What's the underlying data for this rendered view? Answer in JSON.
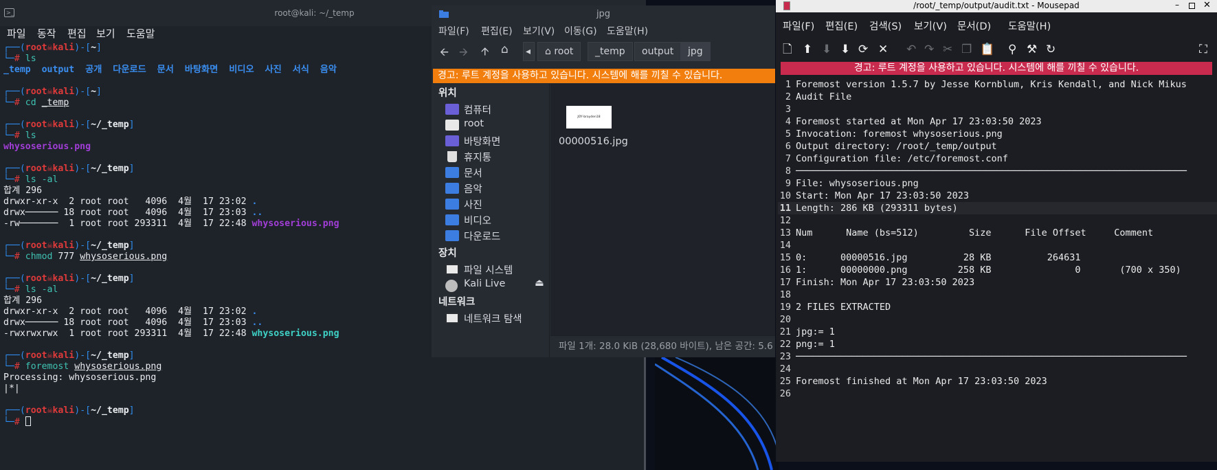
{
  "terminal": {
    "title": "root@kali: ~/_temp",
    "menu": [
      "파일",
      "동작",
      "편집",
      "보기",
      "도움말"
    ],
    "lines": [
      {
        "type": "prompt",
        "user": "root",
        "host": "kali",
        "dir": "~"
      },
      {
        "type": "cmd",
        "parts": [
          {
            "t": "ls",
            "c": "cmd"
          }
        ]
      },
      {
        "type": "out",
        "parts": [
          {
            "t": "_temp  output  공개  다운로드  문서  바탕화면  비디오  사진  서식  음악",
            "c": "dirblue"
          }
        ]
      },
      {
        "type": "blank"
      },
      {
        "type": "prompt",
        "user": "root",
        "host": "kali",
        "dir": "~"
      },
      {
        "type": "cmd",
        "parts": [
          {
            "t": "cd ",
            "c": "cmd"
          },
          {
            "t": "_temp",
            "c": "wh ul"
          }
        ]
      },
      {
        "type": "blank"
      },
      {
        "type": "prompt",
        "user": "root",
        "host": "kali",
        "dir": "~/_temp"
      },
      {
        "type": "cmd",
        "parts": [
          {
            "t": "ls",
            "c": "cmd"
          }
        ]
      },
      {
        "type": "out",
        "parts": [
          {
            "t": "whysoserious.png",
            "c": "pu"
          }
        ]
      },
      {
        "type": "blank"
      },
      {
        "type": "prompt",
        "user": "root",
        "host": "kali",
        "dir": "~/_temp"
      },
      {
        "type": "cmd",
        "parts": [
          {
            "t": "ls -al",
            "c": "cmd"
          }
        ]
      },
      {
        "type": "out",
        "parts": [
          {
            "t": "합계 296",
            "c": "wh"
          }
        ]
      },
      {
        "type": "out",
        "parts": [
          {
            "t": "drwxr-xr-x  2 root root   4096  4월  17 23:02 ",
            "c": "wh"
          },
          {
            "t": ".",
            "c": "dirblue"
          }
        ]
      },
      {
        "type": "out",
        "parts": [
          {
            "t": "drwx────── 18 root root   4096  4월  17 23:03 ",
            "c": "wh"
          },
          {
            "t": "..",
            "c": "dirblue"
          }
        ]
      },
      {
        "type": "out",
        "parts": [
          {
            "t": "-rw───────  1 root root 293311  4월  17 22:48 ",
            "c": "wh"
          },
          {
            "t": "whysoserious.png",
            "c": "pu"
          }
        ]
      },
      {
        "type": "blank"
      },
      {
        "type": "prompt",
        "user": "root",
        "host": "kali",
        "dir": "~/_temp"
      },
      {
        "type": "cmd",
        "parts": [
          {
            "t": "chmod ",
            "c": "cmd"
          },
          {
            "t": "777 ",
            "c": "wh"
          },
          {
            "t": "whysoserious.png",
            "c": "wh ul"
          }
        ]
      },
      {
        "type": "blank"
      },
      {
        "type": "prompt",
        "user": "root",
        "host": "kali",
        "dir": "~/_temp"
      },
      {
        "type": "cmd",
        "parts": [
          {
            "t": "ls -al",
            "c": "cmd"
          }
        ]
      },
      {
        "type": "out",
        "parts": [
          {
            "t": "합계 296",
            "c": "wh"
          }
        ]
      },
      {
        "type": "out",
        "parts": [
          {
            "t": "drwxr-xr-x  2 root root   4096  4월  17 23:02 ",
            "c": "wh"
          },
          {
            "t": ".",
            "c": "dirblue"
          }
        ]
      },
      {
        "type": "out",
        "parts": [
          {
            "t": "drwx────── 18 root root   4096  4월  17 23:03 ",
            "c": "wh"
          },
          {
            "t": "..",
            "c": "dirblue"
          }
        ]
      },
      {
        "type": "out",
        "parts": [
          {
            "t": "-rwxrwxrwx  1 root root 293311  4월  17 22:48 ",
            "c": "wh"
          },
          {
            "t": "whysoserious.png",
            "c": "cy"
          }
        ]
      },
      {
        "type": "blank"
      },
      {
        "type": "prompt",
        "user": "root",
        "host": "kali",
        "dir": "~/_temp"
      },
      {
        "type": "cmd",
        "parts": [
          {
            "t": "foremost ",
            "c": "cmd"
          },
          {
            "t": "whysoserious.png",
            "c": "wh ul"
          }
        ]
      },
      {
        "type": "out",
        "parts": [
          {
            "t": "Processing: whysoserious.png",
            "c": "wh"
          }
        ]
      },
      {
        "type": "out",
        "parts": [
          {
            "t": "|*|",
            "c": "wh"
          }
        ]
      },
      {
        "type": "blank"
      },
      {
        "type": "prompt",
        "user": "root",
        "host": "kali",
        "dir": "~/_temp"
      },
      {
        "type": "cursorline"
      }
    ]
  },
  "filemanager": {
    "title": "jpg",
    "menu": [
      "파일(F)",
      "편집(E)",
      "보기(V)",
      "이동(G)",
      "도움말(H)"
    ],
    "breadcrumbs": [
      "root",
      "_temp",
      "output",
      "jpg"
    ],
    "warning": "경고: 루트 계정을 사용하고 있습니다. 시스템에 해를 끼칠 수 있습니다.",
    "places_header": "위치",
    "places": [
      {
        "label": "컴퓨터",
        "icon": "computer-icon",
        "color": "#6a5fd6"
      },
      {
        "label": "root",
        "icon": "home-folder-icon",
        "color": "#e8e8e8"
      },
      {
        "label": "바탕화면",
        "icon": "desktop-icon",
        "color": "#6a5fd6"
      },
      {
        "label": "휴지통",
        "icon": "trash-icon",
        "color": "#e0e0e0"
      },
      {
        "label": "문서",
        "icon": "documents-folder-icon",
        "color": "#3b7de0"
      },
      {
        "label": "음악",
        "icon": "music-folder-icon",
        "color": "#3b7de0"
      },
      {
        "label": "사진",
        "icon": "pictures-folder-icon",
        "color": "#3b7de0"
      },
      {
        "label": "비디오",
        "icon": "videos-folder-icon",
        "color": "#3b7de0"
      },
      {
        "label": "다운로드",
        "icon": "downloads-folder-icon",
        "color": "#3b7de0"
      }
    ],
    "devices_header": "장치",
    "devices": [
      {
        "label": "파일 시스템",
        "icon": "drive-icon"
      },
      {
        "label": "Kali Live",
        "icon": "disc-icon"
      }
    ],
    "network_header": "네트워크",
    "network": [
      {
        "label": "네트워크 탐색",
        "icon": "network-icon"
      }
    ],
    "file": {
      "name": "00000516.jpg",
      "thumb_text": "JOY·brayden18"
    },
    "status": "파일 1개: 28.0 KiB (28,680 바이트), 남은 공간: 5.6"
  },
  "mousepad": {
    "title": "/root/_temp/output/audit.txt - Mousepad",
    "menu": [
      "파일(F)",
      "편집(E)",
      "검색(S)",
      "보기(V)",
      "문서(D)",
      "도움말(H)"
    ],
    "warning": "경고: 루트 계정을 사용하고 있습니다. 시스템에 해를 끼칠 수 있습니다.",
    "lines": [
      "Foremost version 1.5.7 by Jesse Kornblum, Kris Kendall, and Nick Mikus",
      "Audit File",
      "",
      "Foremost started at Mon Apr 17 23:03:50 2023",
      "Invocation: foremost whysoserious.png",
      "Output directory: /root/_temp/output",
      "Configuration file: /etc/foremost.conf",
      "──────────────────────────────────────────────────────────────────────",
      "File: whysoserious.png",
      "Start: Mon Apr 17 23:03:50 2023",
      "Length: 286 KB (293311 bytes)",
      "",
      "Num      Name (bs=512)         Size      File Offset     Comment",
      "",
      "0:      00000516.jpg          28 KB          264631",
      "1:      00000000.png         258 KB               0       (700 x 350)",
      "Finish: Mon Apr 17 23:03:50 2023",
      "",
      "2 FILES EXTRACTED",
      "",
      "jpg:= 1",
      "png:= 1",
      "──────────────────────────────────────────────────────────────────────",
      "",
      "Foremost finished at Mon Apr 17 23:03:50 2023",
      ""
    ]
  }
}
